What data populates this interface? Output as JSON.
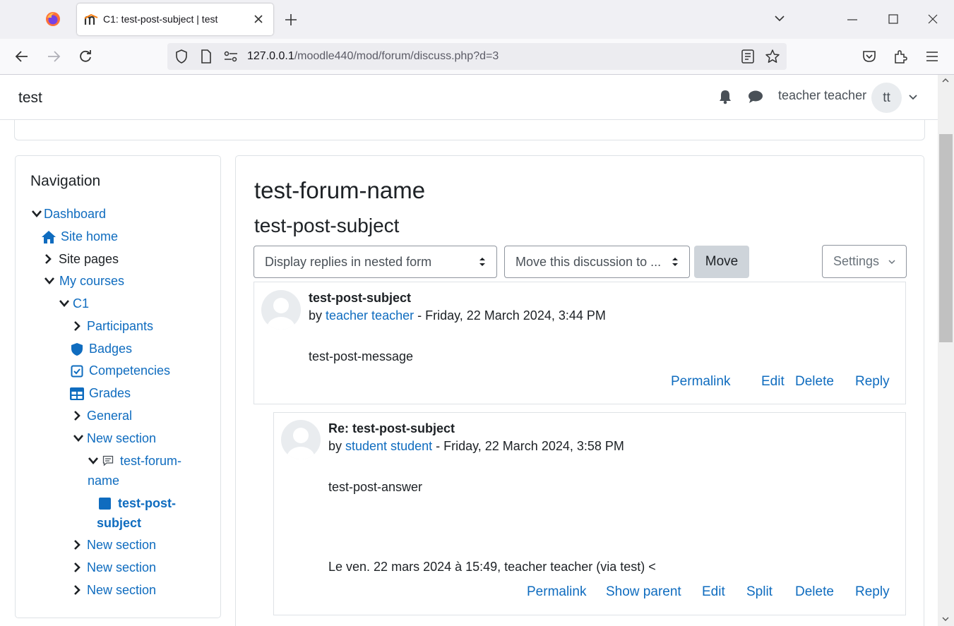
{
  "browser": {
    "tab_title": "C1: test-post-subject | test",
    "url_host": "127.0.0.1",
    "url_path": "/moodle440/mod/forum/discuss.php?d=3"
  },
  "header": {
    "site_name": "test",
    "user_name": "teacher teacher",
    "avatar_initials": "tt"
  },
  "navigation": {
    "title": "Navigation",
    "items": [
      {
        "label": "Dashboard"
      },
      {
        "label": "Site home"
      },
      {
        "label": "Site pages"
      },
      {
        "label": "My courses"
      },
      {
        "label": "C1"
      },
      {
        "label": "Participants"
      },
      {
        "label": "Badges"
      },
      {
        "label": "Competencies"
      },
      {
        "label": "Grades"
      },
      {
        "label": "General"
      },
      {
        "label": "New section"
      },
      {
        "label_line1": "test-forum-",
        "label_line2": "name"
      },
      {
        "label_line1": "test-post-",
        "label_line2": "subject"
      },
      {
        "label": "New section"
      },
      {
        "label": "New section"
      },
      {
        "label": "New section"
      }
    ]
  },
  "main": {
    "forum_name": "test-forum-name",
    "discussion_subject": "test-post-subject",
    "display_mode_select": "Display replies in nested form",
    "move_select": "Move this discussion to ...",
    "move_button": "Move",
    "settings_button": "Settings"
  },
  "posts": [
    {
      "subject": "test-post-subject",
      "by": "by ",
      "author": "teacher teacher",
      "date": " - Friday, 22 March 2024, 3:44 PM",
      "message": "test-post-message",
      "actions": [
        "Permalink",
        "Edit",
        "Delete",
        "Reply"
      ]
    },
    {
      "subject": "Re: test-post-subject",
      "by": "by ",
      "author": "student student",
      "date": " - Friday, 22 March 2024, 3:58 PM",
      "message": "test-post-answer",
      "quote": "Le ven. 22 mars 2024 à 15:49, teacher teacher (via test) <",
      "actions": [
        "Permalink",
        "Show parent",
        "Edit",
        "Split",
        "Delete",
        "Reply"
      ]
    }
  ]
}
